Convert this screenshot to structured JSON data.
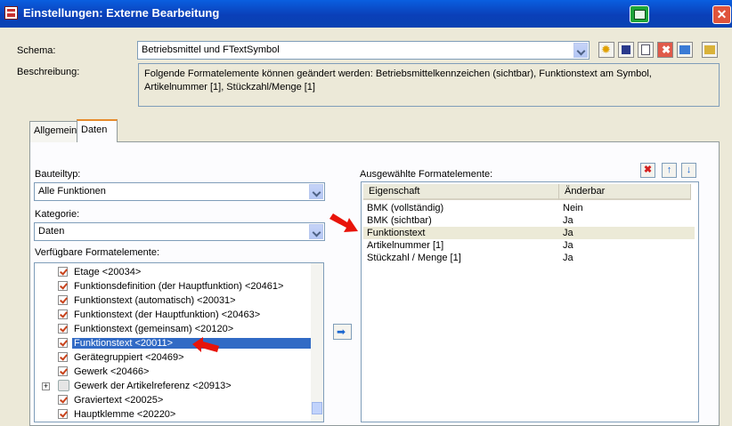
{
  "window": {
    "title": "Einstellungen: Externe Bearbeitung"
  },
  "schema": {
    "label": "Schema:",
    "value": "Betriebsmittel und FTextSymbol",
    "toolbar_icons": [
      "new-icon",
      "save-icon",
      "copy-icon",
      "delete-icon",
      "export-icon",
      "import-icon"
    ]
  },
  "description": {
    "label": "Beschreibung:",
    "text": "Folgende Formatelemente können geändert werden: Betriebsmittelkennzeichen (sichtbar), Funktionstext am Symbol, Artikelnummer [1], Stückzahl/Menge [1]"
  },
  "tabs": [
    {
      "label": "Allgemein",
      "active": false
    },
    {
      "label": "Daten",
      "active": true
    }
  ],
  "bauteiltyp": {
    "label": "Bauteiltyp:",
    "value": "Alle Funktionen"
  },
  "kategorie": {
    "label": "Kategorie:",
    "value": "Daten"
  },
  "available": {
    "label": "Verfügbare Formatelemente:",
    "items": [
      {
        "text": "Etage <20034>"
      },
      {
        "text": "Funktionsdefinition (der Hauptfunktion) <20461>"
      },
      {
        "text": "Funktionstext (automatisch) <20031>"
      },
      {
        "text": "Funktionstext (der Hauptfunktion) <20463>"
      },
      {
        "text": "Funktionstext (gemeinsam) <20120>"
      },
      {
        "text": "Funktionstext <20011>",
        "selected": true
      },
      {
        "text": "Gerätegruppiert <20469>"
      },
      {
        "text": "Gewerk <20466>"
      },
      {
        "text": "Gewerk der Artikelreferenz <20913>",
        "group": true,
        "expander": "+"
      },
      {
        "text": "Graviertext <20025>"
      },
      {
        "text": "Hauptklemme <20220>"
      }
    ]
  },
  "selected": {
    "label": "Ausgewählte Formatelemente:",
    "columns": [
      "Eigenschaft",
      "Änderbar"
    ],
    "rows": [
      {
        "eigenschaft": "BMK (vollständig)",
        "aenderbar": "Nein"
      },
      {
        "eigenschaft": "BMK (sichtbar)",
        "aenderbar": "Ja"
      },
      {
        "eigenschaft": "Funktionstext",
        "aenderbar": "Ja",
        "selected": true
      },
      {
        "eigenschaft": "Artikelnummer [1]",
        "aenderbar": "Ja"
      },
      {
        "eigenschaft": "Stückzahl / Menge [1]",
        "aenderbar": "Ja"
      }
    ]
  }
}
